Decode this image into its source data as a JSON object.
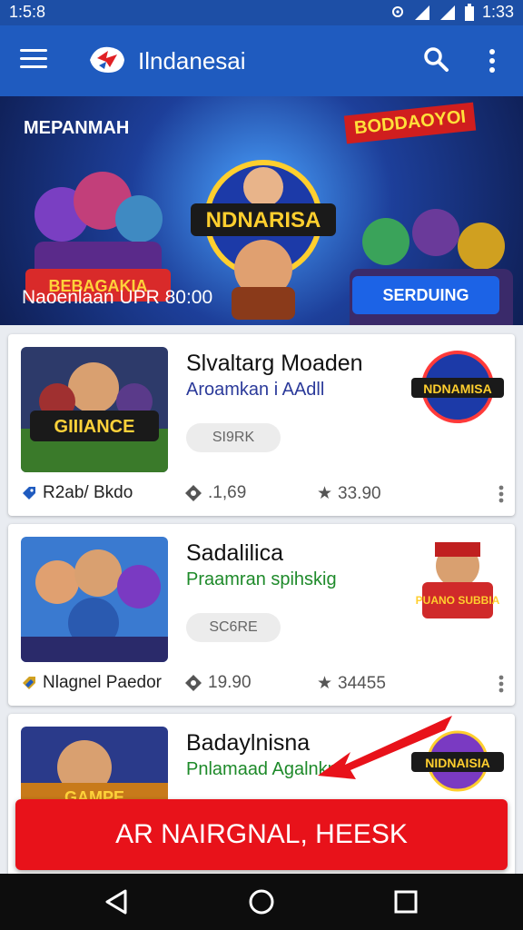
{
  "status": {
    "time_left": "1:5:8",
    "time_right": "1:33"
  },
  "appbar": {
    "title": "Ilndanesai"
  },
  "banner": {
    "top_left": "MEPANMAH",
    "ribbon": "BODDAOYOI",
    "center_logo": "NDNARISA",
    "left_logo": "BEBAGAKIA",
    "subtitle": "Naoenlaan UPR 80:00",
    "cta": "SERDUING"
  },
  "cards": [
    {
      "name": "Slvaltarg Moaden",
      "sub": "Aroamkan i AAdll",
      "sub_color": "#2b3a9a",
      "pill": "SI9RK",
      "publisher": "R2ab/ Bkdo",
      "downloads": ".1,69",
      "rating": "33.90",
      "badge_text": "NDNAMISA",
      "thumb_text": "GIIIANCE"
    },
    {
      "name": "Sadalilica",
      "sub": "Praamran spihskig",
      "sub_color": "#1e8a2a",
      "pill": "SC6RE",
      "publisher": "Nlagnel Paedor",
      "downloads": "19.90",
      "rating": "34455",
      "badge_text": "PUANO SUBBIA",
      "thumb_text": ""
    },
    {
      "name": "Badaylnisna",
      "sub": "Pnlamaad Agalnkn",
      "sub_color": "#1e8a2a",
      "badge_text": "NIDNAISIA",
      "thumb_text": "GAMPE"
    }
  ],
  "big_button": "AR NAIRGNAL, HEESK",
  "colors": {
    "appbar": "#1f5bbf",
    "cta_red": "#e8121a",
    "banner_btn": "#1c63e6"
  }
}
